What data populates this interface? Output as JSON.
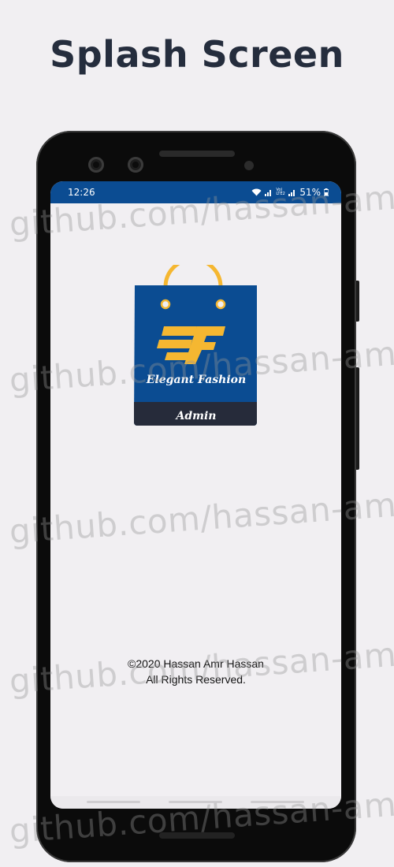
{
  "heading": "Splash Screen",
  "status_bar": {
    "time": "12:26",
    "battery": "51%",
    "network": "Vo) LTE2",
    "bg_color": "#0b4c92"
  },
  "logo": {
    "monogram": "EF",
    "brand": "Elegant Fashion",
    "sub_label": "Admin",
    "bag_color": "#0b4c92",
    "accent_color": "#f5b731",
    "band_color": "#262b3a"
  },
  "footer": {
    "copyright": "©2020 Hassan Amr Hassan",
    "rights": "All Rights Reserved."
  },
  "watermark": "github.com/hassan-amr"
}
